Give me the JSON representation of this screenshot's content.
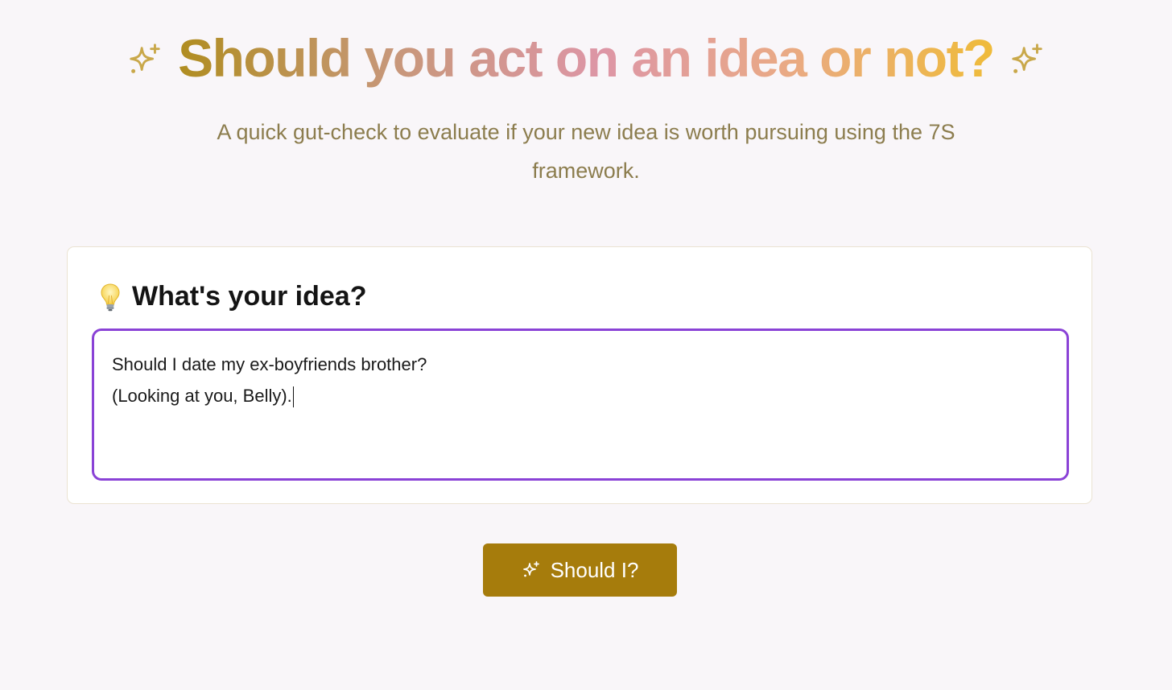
{
  "header": {
    "title": "Should you act on an idea or not?",
    "left_icon": "sparkles-icon",
    "right_icon": "sparkles-icon",
    "gradient_colors": [
      "#b08d20",
      "#c79779",
      "#dd96a6",
      "#e9a986",
      "#efbb3a"
    ]
  },
  "subtitle": "A quick gut-check to evaluate if your new idea is worth pursuing using the 7S framework.",
  "idea_card": {
    "icon": "lightbulb-icon",
    "heading": "What's your idea?",
    "input_value": "Should I date my ex-boyfriends brother?\n(Looking at you, Belly).",
    "input_border_color": "#8a42d6"
  },
  "submit_button": {
    "label": "Should I?",
    "icon": "sparkles-icon",
    "color": "#a67c0c"
  },
  "colors": {
    "background": "#f9f6f9",
    "subtitle": "#8c7d4e",
    "sparkle": "#c9a84a"
  }
}
